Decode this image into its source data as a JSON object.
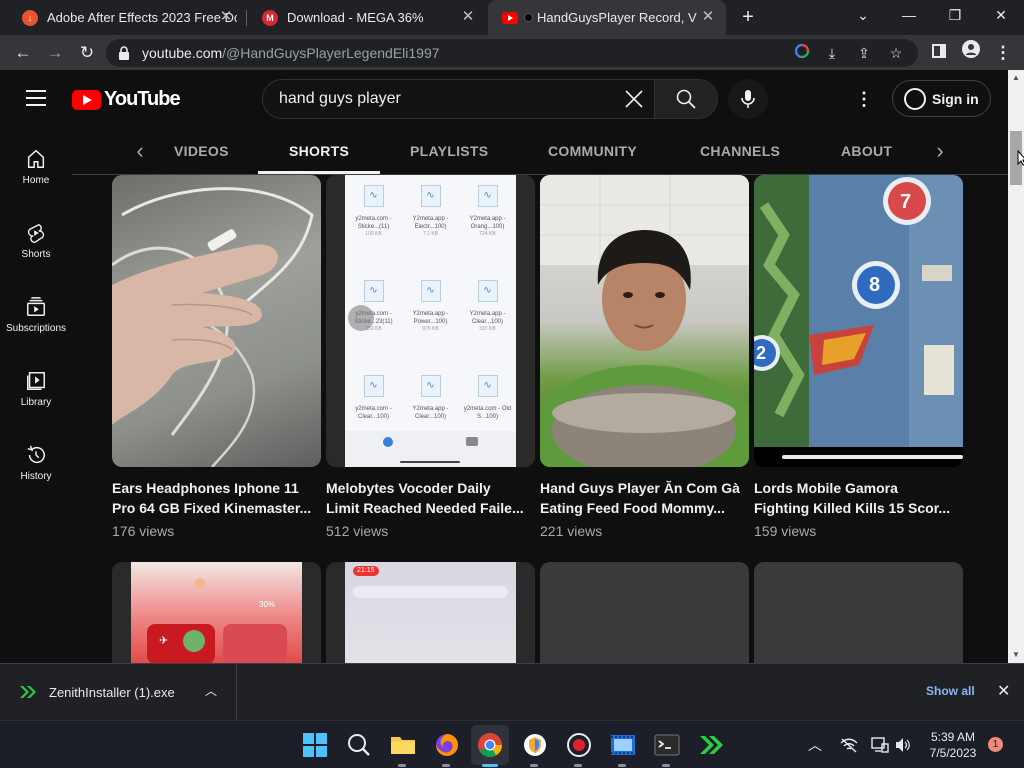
{
  "browser": {
    "tabs": [
      {
        "title": "Adobe After Effects 2023 Free Do",
        "favicon": "download-favicon",
        "color": "#e8542f"
      },
      {
        "title": "Download - MEGA 36%",
        "favicon": "mega-favicon",
        "color": "#d9272e"
      },
      {
        "title": "HandGuysPlayer Record, Vide",
        "favicon": "youtube-favicon",
        "color": "#ff0000"
      }
    ],
    "url_host": "youtube.com",
    "url_path": "/@HandGuysPlayerLegendEli1997"
  },
  "youtube": {
    "logo": "YouTube",
    "search_query": "hand guys player",
    "sign_in": "Sign in",
    "sidebar": [
      {
        "label": "Home",
        "icon": "home-icon"
      },
      {
        "label": "Shorts",
        "icon": "shorts-icon"
      },
      {
        "label": "Subscriptions",
        "icon": "subscriptions-icon"
      },
      {
        "label": "Library",
        "icon": "library-icon"
      },
      {
        "label": "History",
        "icon": "history-icon"
      }
    ],
    "channel_tabs": [
      "VIDEOS",
      "SHORTS",
      "PLAYLISTS",
      "COMMUNITY",
      "CHANNELS",
      "ABOUT"
    ],
    "active_tab": "SHORTS",
    "shorts": [
      {
        "title_line1": "Ears Headphones Iphone 11",
        "title_line2": "Pro 64 GB Fixed Kinemaster...",
        "views": "176 views"
      },
      {
        "title_line1": "Melobytes Vocoder Daily",
        "title_line2": "Limit Reached Needed Faile...",
        "views": "512 views"
      },
      {
        "title_line1": "Hand Guys Player Ăn Com Gà",
        "title_line2": "Eating Feed Food Mommy...",
        "views": "221 views"
      },
      {
        "title_line1": "Lords Mobile Gamora",
        "title_line2": "Fighting Killed Kills 15 Scor...",
        "views": "159 views"
      }
    ],
    "thumb2_files": [
      {
        "name": "y2meta.com - Sticke...(11)",
        "size": "100 KB"
      },
      {
        "name": "Y2meta.app - Electr...100)",
        "size": "7.1 KB"
      },
      {
        "name": "Y2meta.app - Orang...100)",
        "size": "724 KB"
      },
      {
        "name": "y2meta.com - Sticke...23(11)",
        "size": "253 KB"
      },
      {
        "name": "Y2meta.app - Power...100)",
        "size": "979 KB"
      },
      {
        "name": "Y2meta.app - Clear...100)",
        "size": "337 KB"
      },
      {
        "name": "y2meta.com - Clear...100)",
        "size": ""
      },
      {
        "name": "Y2meta.app - Clear...100)",
        "size": ""
      },
      {
        "name": "y2meta.com - Old S...100)",
        "size": ""
      }
    ],
    "thumb4_numbers": [
      "7",
      "8",
      "2"
    ],
    "thumb5_text": "30%",
    "thumb6_time": "21:15"
  },
  "download_bar": {
    "filename": "ZenithInstaller (1).exe",
    "show_all": "Show all"
  },
  "taskbar": {
    "time": "5:39 AM",
    "date": "7/5/2023",
    "notifications": "1"
  },
  "colors": {
    "youtube_red": "#ff0000",
    "link_blue": "#8ab4f8",
    "page_bg": "#0f0f0f"
  }
}
